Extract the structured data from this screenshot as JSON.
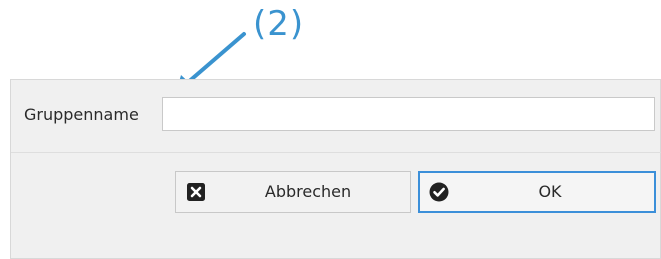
{
  "annotation": {
    "label": "(2)",
    "color": "#3a93cf"
  },
  "dialog": {
    "group_name": {
      "label": "Gruppenname",
      "value": "",
      "placeholder": ""
    },
    "buttons": {
      "cancel": {
        "label": "Abbrechen",
        "icon": "close-square-icon"
      },
      "ok": {
        "label": "OK",
        "icon": "check-circle-icon",
        "focus_color": "#3b8fd9"
      }
    }
  }
}
